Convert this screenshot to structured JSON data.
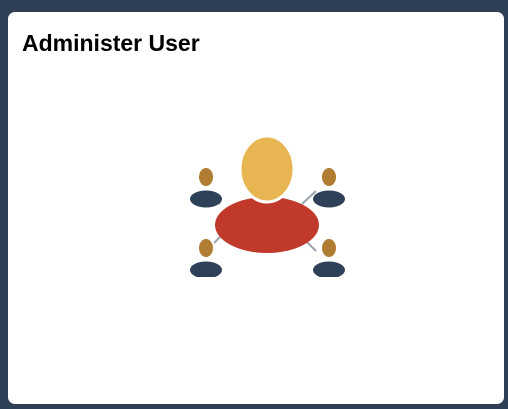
{
  "tile": {
    "title": "Administer User",
    "icon": "user-network-icon"
  },
  "colors": {
    "frame": "#2e3f55",
    "tile_background": "#ffffff",
    "title_text": "#000000",
    "main_user_head": "#e8b553",
    "main_user_body": "#c1392b",
    "small_user_head": "#b07d32",
    "small_user_body": "#2f4159",
    "connector": "#9aa3ad"
  }
}
